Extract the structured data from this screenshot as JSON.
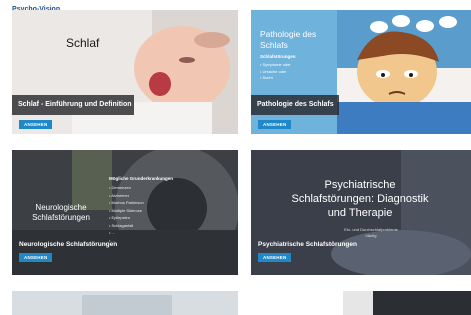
{
  "site": {
    "logo": "Psycho-Vision"
  },
  "cards": [
    {
      "headline": "Schlaf",
      "caption": "Schlaf - Einführung und Definition",
      "button": "ANSEHEN"
    },
    {
      "title_line1": "Pathologie des",
      "title_line2": "Schlafs",
      "subtitle": "Schlafstörungen",
      "bullets": [
        "• Symptome oder",
        "• Ursache oder",
        "• Sucht"
      ],
      "caption": "Pathologie des Schlafs",
      "button": "ANSEHEN"
    },
    {
      "title_line1": "Neurologische",
      "title_line2": "Schlafstörungen",
      "list_heading": "Mögliche Grunderkrankungen",
      "list": [
        "• Demenzen",
        "• Alzheimer",
        "• Morbus Parkinson",
        "• Multiple Sklerose",
        "• Epilepsien",
        "• Schlaganfall",
        "• ...",
        "• ..."
      ],
      "caption": "Neurologische Schlafstörungen",
      "button": "ANSEHEN"
    },
    {
      "title_line1": "Psychiatrische",
      "title_line2": "Schlafstörungen: Diagnostik",
      "title_line3": "und Therapie",
      "subtitle_line1": "Ein- und Durchschlafprobleme",
      "subtitle_line2": "häufig",
      "caption": "Psychiatrische Schlafstörungen",
      "button": "ANSEHEN"
    }
  ],
  "colors": {
    "button": "#1e88c8",
    "pathology_bg": "#6fb2dc",
    "caption_bg": "#28282c"
  }
}
